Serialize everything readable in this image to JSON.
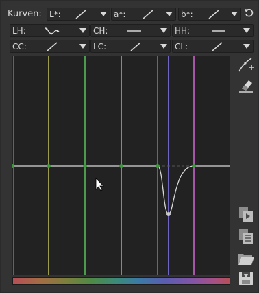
{
  "panel": {
    "title_label": "Kurven:"
  },
  "combos": {
    "l": {
      "label": "L*:",
      "icon": "curve-linear-icon"
    },
    "a": {
      "label": "a*:",
      "icon": "curve-linear-icon"
    },
    "b": {
      "label": "b*:",
      "icon": "curve-linear-icon"
    },
    "lh": {
      "label": "LH:",
      "icon": "curve-wave-icon"
    },
    "ch": {
      "label": "CH:",
      "icon": "curve-flat-icon"
    },
    "hh": {
      "label": "HH:",
      "icon": "curve-flat-icon"
    },
    "cc": {
      "label": "CC:",
      "icon": "curve-linear-icon"
    },
    "lc": {
      "label": "LC:",
      "icon": "curve-linear-icon"
    },
    "cl": {
      "label": "CL:",
      "icon": "curve-linear-icon"
    }
  },
  "side_buttons": [
    "curve-edit-icon",
    "eraser-icon",
    "copy-icon",
    "list-icon",
    "folder-open-icon",
    "save-icon"
  ],
  "colors": {
    "panel_bg": "#333333",
    "graph_bg": "#222222",
    "curve": "#d8d8d8",
    "control_point": "#3c9a3c"
  }
}
